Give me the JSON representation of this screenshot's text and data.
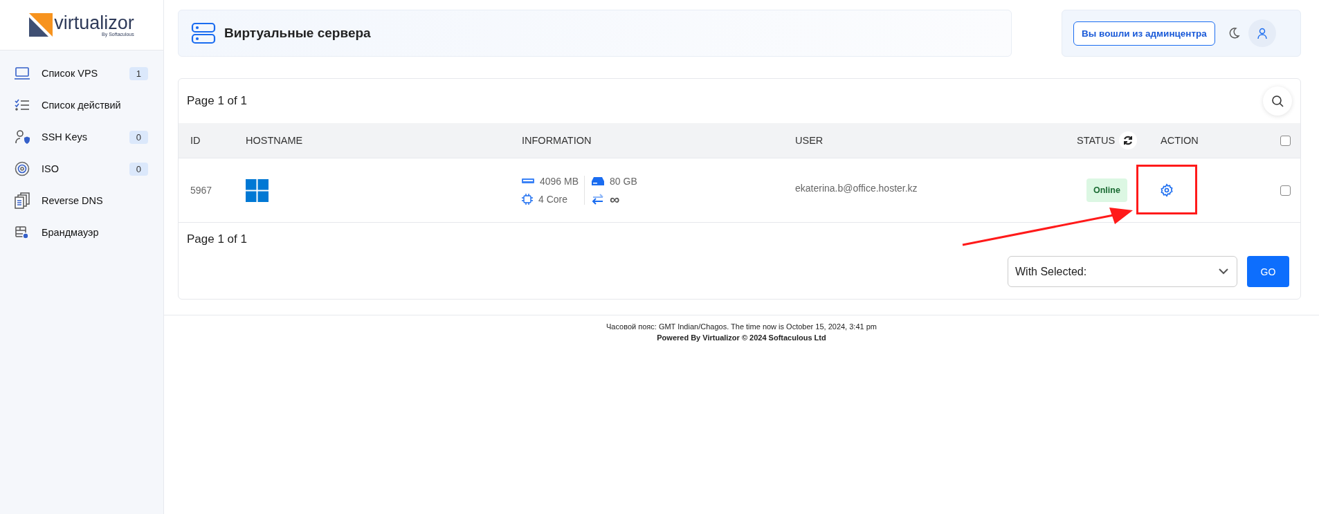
{
  "brand": {
    "name": "virtualizor",
    "tagline": "By Softaculous"
  },
  "sidebar": {
    "items": [
      {
        "kind": "laptop",
        "label": "Список VPS",
        "badge": "1"
      },
      {
        "kind": "checklist",
        "label": "Список действий"
      },
      {
        "kind": "user-shield",
        "label": "SSH Keys",
        "badge": "0"
      },
      {
        "kind": "disc",
        "label": "ISO",
        "badge": "0"
      },
      {
        "kind": "documents",
        "label": "Reverse DNS"
      },
      {
        "kind": "firewall",
        "label": "Брандмауэр"
      }
    ]
  },
  "header": {
    "title": "Виртуальные сервера"
  },
  "account": {
    "admin_button": "Вы вошли из админцентра"
  },
  "table": {
    "pager_top": "Page 1 of 1",
    "columns": [
      "ID",
      "HOSTNAME",
      "INFORMATION",
      "USER",
      "STATUS",
      "ACTION"
    ],
    "select_all_checked": false,
    "rows": [
      {
        "id": "5967",
        "kind": "windows",
        "ram": "4096 MB",
        "disk": "80 GB",
        "cpu": "4 Core",
        "bandwidth": "∞",
        "user": "ekaterina.b@office.hoster.kz",
        "status": "Online",
        "checked": false
      }
    ],
    "pager_bottom": "Page 1 of 1"
  },
  "bulk": {
    "label": "With Selected:",
    "go": "GO"
  },
  "footer": {
    "timezone": "Часовой пояс: GMT Indian/Chagos. The time now is October 15, 2024, 3:41 pm",
    "powered": "Powered By Virtualizor © 2024 Softaculous Ltd"
  }
}
